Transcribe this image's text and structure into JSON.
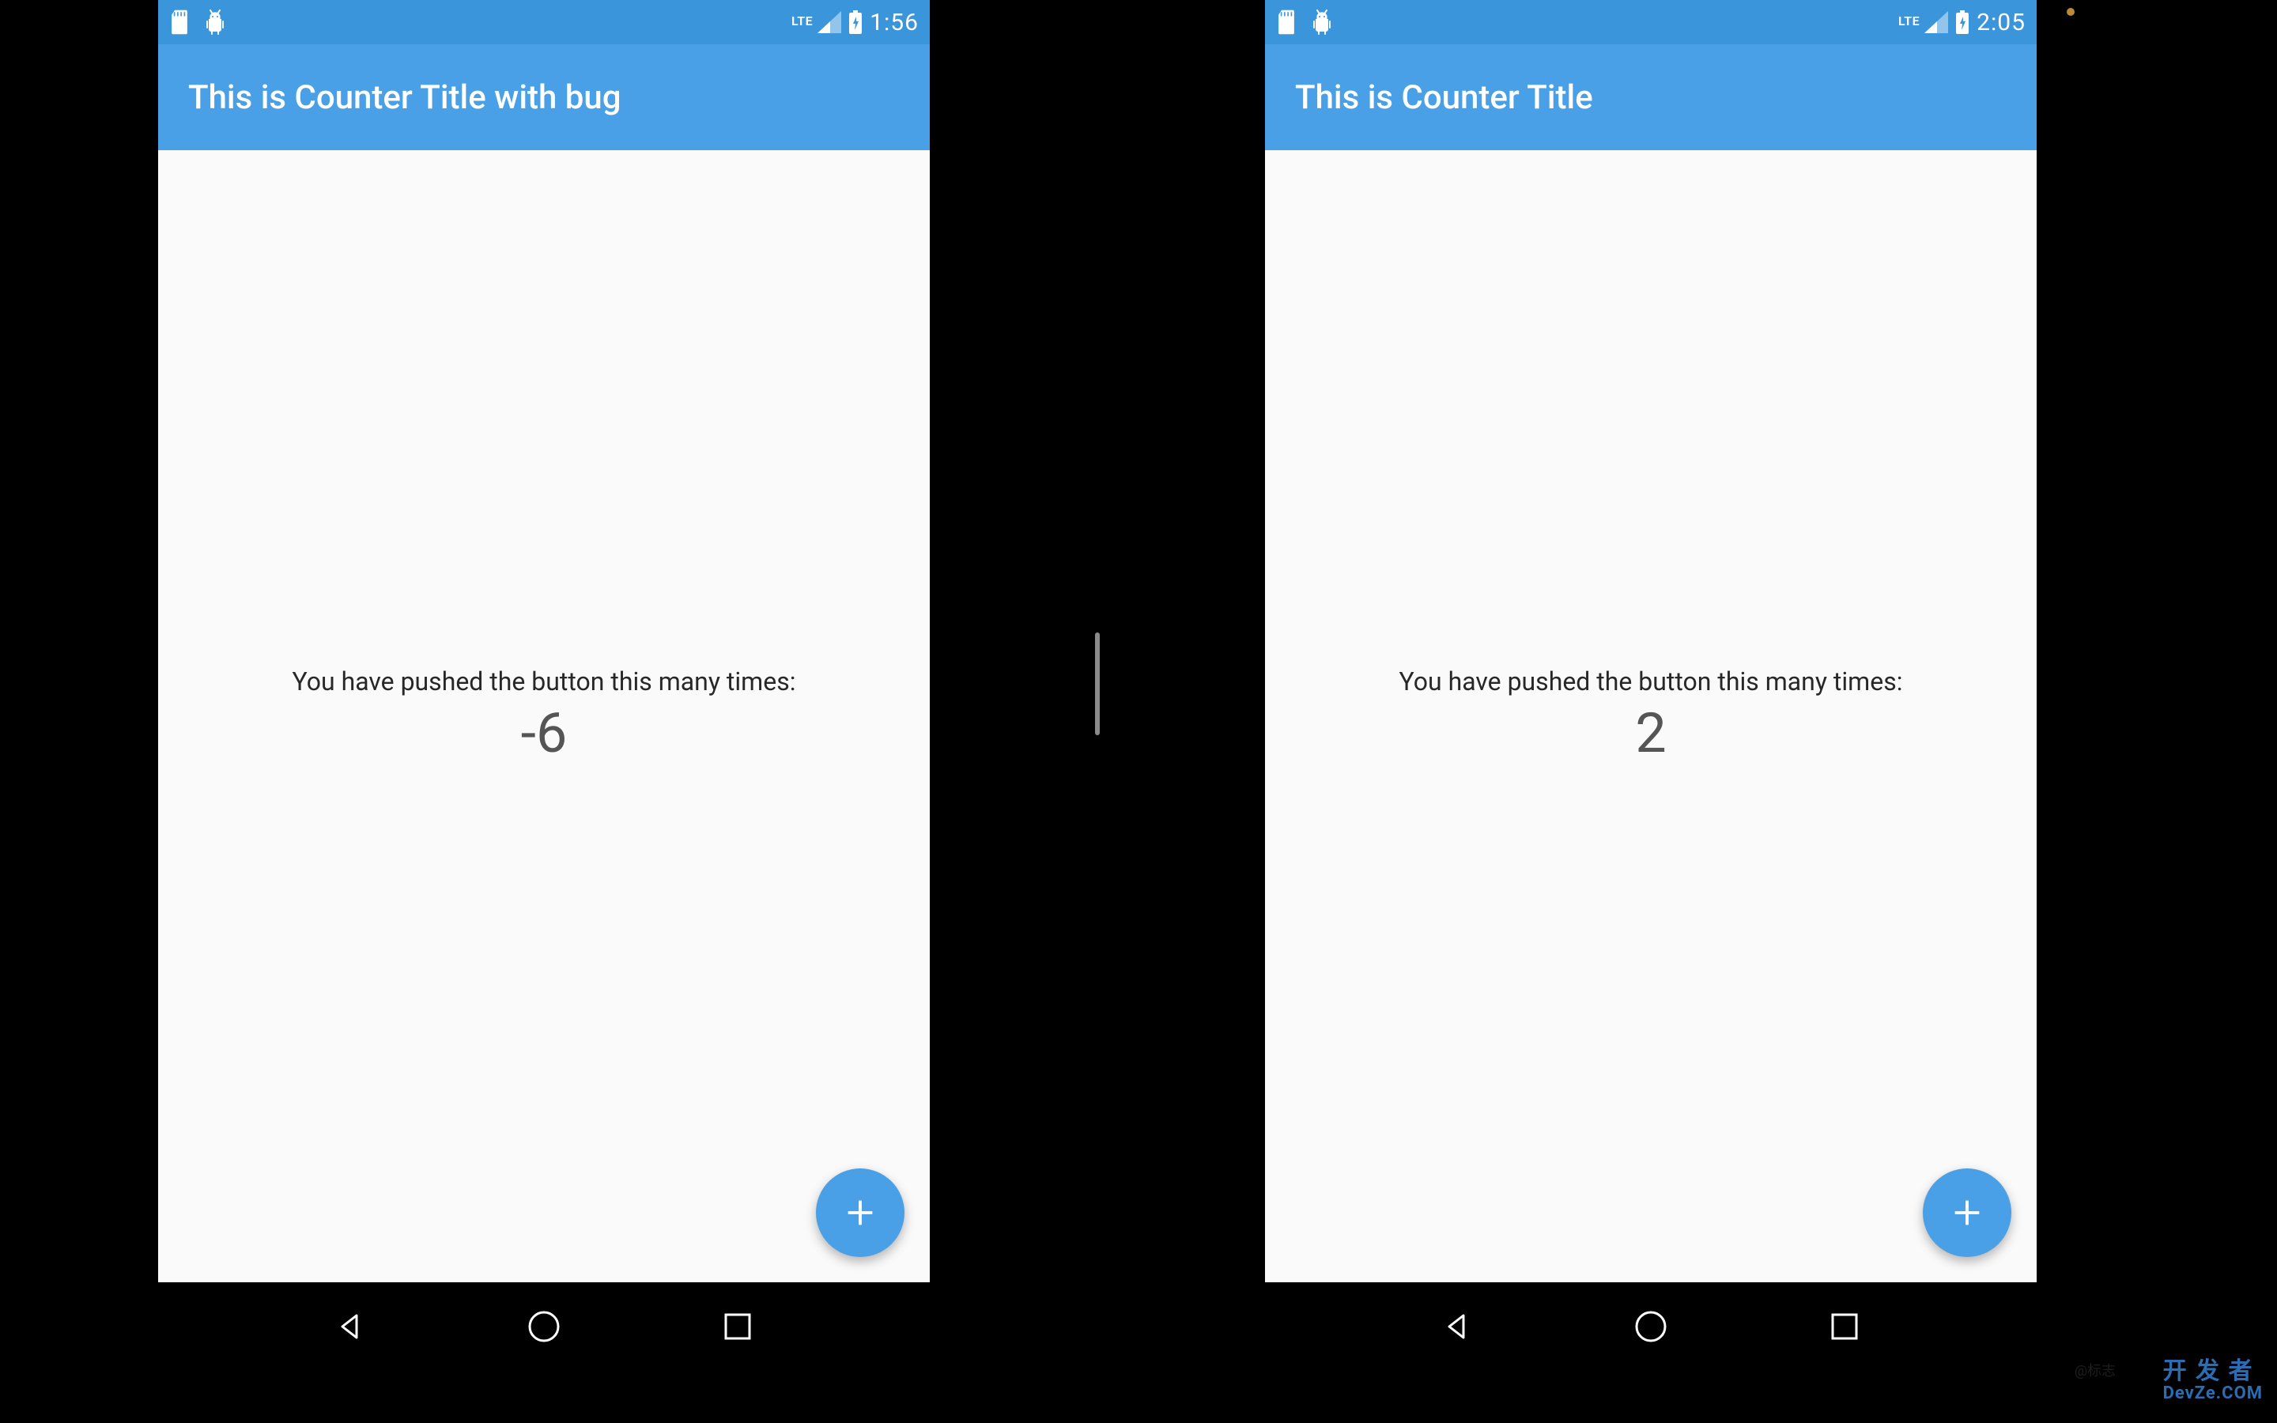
{
  "colors": {
    "status_bar": "#3b95db",
    "app_bar": "#4aa0e6",
    "fab": "#4aa0e6",
    "background": "#fafafa"
  },
  "left": {
    "status": {
      "time": "1:56",
      "lte_label": "LTE"
    },
    "app_bar": {
      "title": "This is Counter Title with bug"
    },
    "content": {
      "label": "You have pushed the button this many times:",
      "count": "-6"
    },
    "fab": {
      "icon": "plus-icon",
      "aria_label": "Increment"
    }
  },
  "right": {
    "status": {
      "time": "2:05",
      "lte_label": "LTE"
    },
    "app_bar": {
      "title": "This is Counter Title"
    },
    "content": {
      "label": "You have pushed the button this many times:",
      "count": "2"
    },
    "fab": {
      "icon": "plus-icon",
      "aria_label": "Increment"
    }
  },
  "nav": {
    "back": "back-icon",
    "home": "home-icon",
    "recent": "recent-icon"
  },
  "watermark": {
    "line1": "开 发 者",
    "line2": "DevZe.COM",
    "gray": "@标志"
  }
}
